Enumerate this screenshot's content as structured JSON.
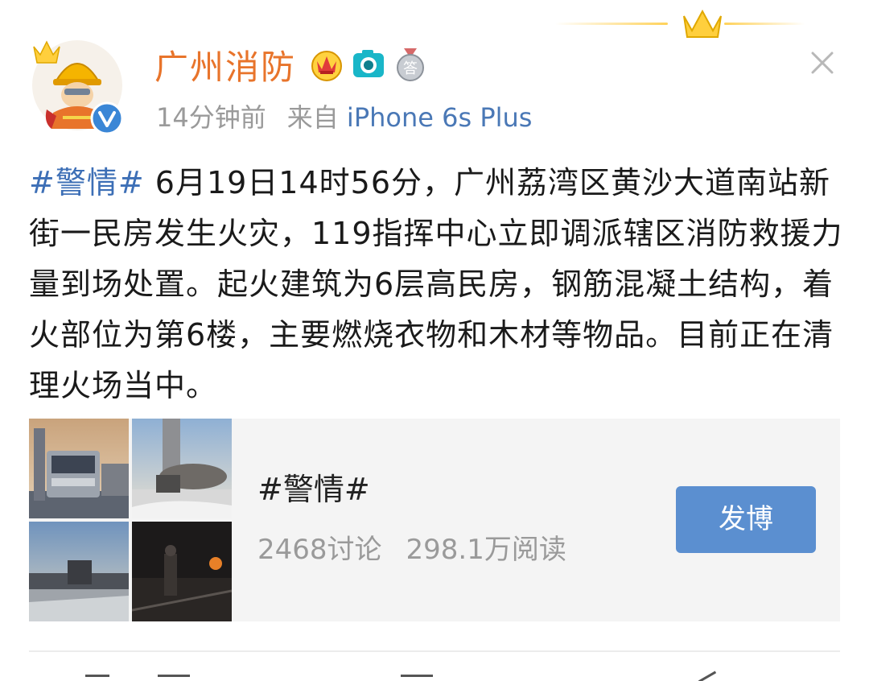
{
  "colors": {
    "username": "#e8742b",
    "link": "#3d6fb6",
    "button": "#5b8fd0",
    "gold": "#ffd25a"
  },
  "post": {
    "author": "广州消防",
    "time": "14分钟前",
    "source_prefix": "来自",
    "source_device": "iPhone 6s Plus",
    "hashtag": "#警情#",
    "body": " 6月19日14时56分，广州荔湾区黄沙大道南站新街一民房发生火灾，119指挥中心立即调派辖区消防救援力量到场处置。起火建筑为6层高民房，钢筋混凝土结构，着火部位为第6楼，主要燃烧衣物和木材等物品。目前正在清理火场当中。",
    "badges": [
      "crown-badge-icon",
      "camera-badge-icon",
      "medal-badge-icon"
    ]
  },
  "topic_card": {
    "title": "#警情#",
    "discussions": "2468讨论",
    "reads": "298.1万阅读",
    "button_label": "发博"
  }
}
